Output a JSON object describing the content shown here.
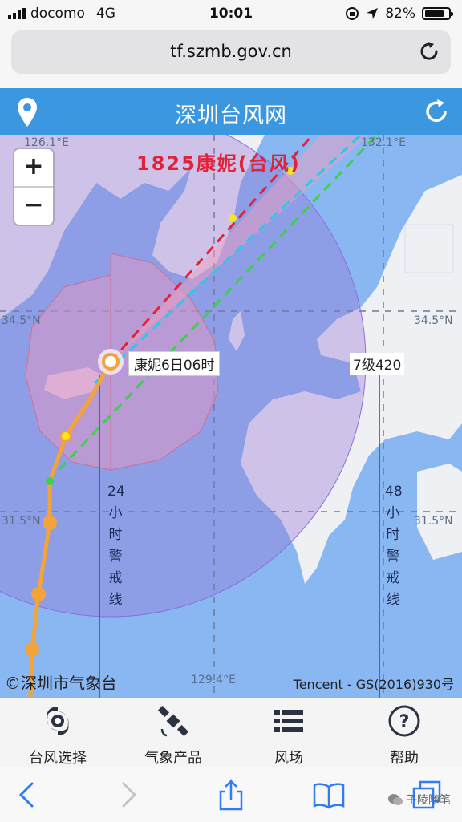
{
  "status_bar": {
    "carrier": "docomo",
    "network": "4G",
    "time": "10:01",
    "battery": "82%",
    "battery_level": 0.82
  },
  "browser": {
    "url": "tf.szmb.gov.cn"
  },
  "header": {
    "title": "深圳台风网"
  },
  "map": {
    "storm_title": "1825康妮(台风)",
    "zoom_in": "+",
    "zoom_out": "−",
    "coords": {
      "lon_left_top": "126.1°E",
      "lon_right_top": "132.1°E",
      "lon_bottom": "129.4°E",
      "lat_upper_left": "34.5°N",
      "lat_upper_right": "34.5°N",
      "lat_lower_left": "31.5°N",
      "lat_lower_right": "31.5°N"
    },
    "position_tip": "康妮6日06时",
    "wind_radius_tip": "7级420",
    "warn_24": {
      "num": "24",
      "chars": [
        "小",
        "时",
        "警",
        "戒",
        "线"
      ]
    },
    "warn_48": {
      "num": "48",
      "chars": [
        "小",
        "时",
        "警",
        "戒",
        "线"
      ]
    },
    "copyright": "©深圳市气象台",
    "tencent": "Tencent - GS(2016)930号"
  },
  "tabs": [
    {
      "label": "台风选择",
      "icon": "typhoon-icon"
    },
    {
      "label": "气象产品",
      "icon": "satellite-icon"
    },
    {
      "label": "风场",
      "icon": "list-icon"
    },
    {
      "label": "帮助",
      "icon": "help-icon"
    }
  ],
  "watermark": "子陵随笔",
  "colors": {
    "header": "#3b97e0",
    "map_sea": "#89b7f2",
    "track": "#f2a43a",
    "storm_title": "#e0223a"
  }
}
